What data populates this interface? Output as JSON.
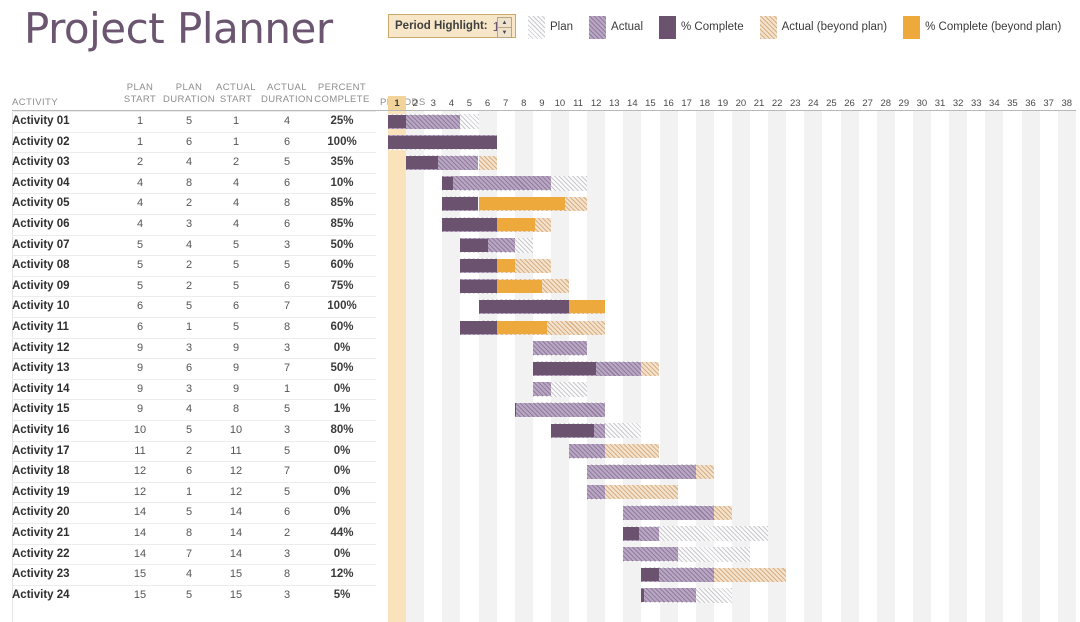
{
  "header": {
    "title": "Project Planner",
    "period_highlight": {
      "label": "Period Highlight:",
      "value": "1",
      "up_icon": "▲",
      "down_icon": "▼"
    },
    "legend": [
      {
        "label": "Plan",
        "swatch": "plan",
        "color": "#c9c9cd"
      },
      {
        "label": "Actual",
        "swatch": "actual",
        "color": "#b9a7c4"
      },
      {
        "label": "% Complete",
        "swatch": "complete",
        "color": "#6b5370"
      },
      {
        "label": "Actual (beyond plan)",
        "swatch": "actual-beyond",
        "color": "#d8b084"
      },
      {
        "label": "% Complete (beyond plan)",
        "swatch": "complete-beyond",
        "color": "#eda93c"
      }
    ]
  },
  "columns": {
    "activity": "ACTIVITY",
    "plan_start_l1": "PLAN",
    "plan_start_l2": "START",
    "plan_duration_l1": "PLAN",
    "plan_duration_l2": "DURATION",
    "actual_start_l1": "ACTUAL",
    "actual_start_l2": "START",
    "actual_duration_l1": "ACTUAL",
    "actual_duration_l2": "DURATION",
    "percent_complete_l1": "PERCENT",
    "percent_complete_l2": "COMPLETE",
    "periods": "PERIODS"
  },
  "chart_data": {
    "type": "bar",
    "title": "Project Planner",
    "subtype": "gantt",
    "xlabel": "PERIODS",
    "ylabel": "ACTIVITY",
    "xlim": [
      1,
      38
    ],
    "period_count": 38,
    "highlighted_period": 1,
    "grid": true,
    "legend_position": "top-right",
    "series": [
      {
        "name": "Plan",
        "color": "#c9c9cd"
      },
      {
        "name": "Actual",
        "color": "#b9a7c4"
      },
      {
        "name": "% Complete",
        "color": "#6b5370"
      },
      {
        "name": "Actual (beyond plan)",
        "color": "#d8b084"
      },
      {
        "name": "% Complete (beyond plan)",
        "color": "#eda93c"
      }
    ],
    "period_ticks": [
      1,
      2,
      3,
      4,
      5,
      6,
      7,
      8,
      9,
      10,
      11,
      12,
      13,
      14,
      15,
      16,
      17,
      18,
      19,
      20,
      21,
      22,
      23,
      24,
      25,
      26,
      27,
      28,
      29,
      30,
      31,
      32,
      33,
      34,
      35,
      36,
      37,
      38
    ],
    "categories": [
      "Activity 01",
      "Activity 02",
      "Activity 03",
      "Activity 04",
      "Activity 05",
      "Activity 06",
      "Activity 07",
      "Activity 08",
      "Activity 09",
      "Activity 10",
      "Activity 11",
      "Activity 12",
      "Activity 13",
      "Activity 14",
      "Activity 15",
      "Activity 16",
      "Activity 17",
      "Activity 18",
      "Activity 19",
      "Activity 20",
      "Activity 21",
      "Activity 22",
      "Activity 23",
      "Activity 24"
    ],
    "rows": [
      {
        "activity": "Activity 01",
        "plan_start": 1,
        "plan_duration": 5,
        "actual_start": 1,
        "actual_duration": 4,
        "percent_complete": "25%",
        "pct": 25
      },
      {
        "activity": "Activity 02",
        "plan_start": 1,
        "plan_duration": 6,
        "actual_start": 1,
        "actual_duration": 6,
        "percent_complete": "100%",
        "pct": 100
      },
      {
        "activity": "Activity 03",
        "plan_start": 2,
        "plan_duration": 4,
        "actual_start": 2,
        "actual_duration": 5,
        "percent_complete": "35%",
        "pct": 35
      },
      {
        "activity": "Activity 04",
        "plan_start": 4,
        "plan_duration": 8,
        "actual_start": 4,
        "actual_duration": 6,
        "percent_complete": "10%",
        "pct": 10
      },
      {
        "activity": "Activity 05",
        "plan_start": 4,
        "plan_duration": 2,
        "actual_start": 4,
        "actual_duration": 8,
        "percent_complete": "85%",
        "pct": 85
      },
      {
        "activity": "Activity 06",
        "plan_start": 4,
        "plan_duration": 3,
        "actual_start": 4,
        "actual_duration": 6,
        "percent_complete": "85%",
        "pct": 85
      },
      {
        "activity": "Activity 07",
        "plan_start": 5,
        "plan_duration": 4,
        "actual_start": 5,
        "actual_duration": 3,
        "percent_complete": "50%",
        "pct": 50
      },
      {
        "activity": "Activity 08",
        "plan_start": 5,
        "plan_duration": 2,
        "actual_start": 5,
        "actual_duration": 5,
        "percent_complete": "60%",
        "pct": 60
      },
      {
        "activity": "Activity 09",
        "plan_start": 5,
        "plan_duration": 2,
        "actual_start": 5,
        "actual_duration": 6,
        "percent_complete": "75%",
        "pct": 75
      },
      {
        "activity": "Activity 10",
        "plan_start": 6,
        "plan_duration": 5,
        "actual_start": 6,
        "actual_duration": 7,
        "percent_complete": "100%",
        "pct": 100
      },
      {
        "activity": "Activity 11",
        "plan_start": 6,
        "plan_duration": 1,
        "actual_start": 5,
        "actual_duration": 8,
        "percent_complete": "60%",
        "pct": 60
      },
      {
        "activity": "Activity 12",
        "plan_start": 9,
        "plan_duration": 3,
        "actual_start": 9,
        "actual_duration": 3,
        "percent_complete": "0%",
        "pct": 0
      },
      {
        "activity": "Activity 13",
        "plan_start": 9,
        "plan_duration": 6,
        "actual_start": 9,
        "actual_duration": 7,
        "percent_complete": "50%",
        "pct": 50
      },
      {
        "activity": "Activity 14",
        "plan_start": 9,
        "plan_duration": 3,
        "actual_start": 9,
        "actual_duration": 1,
        "percent_complete": "0%",
        "pct": 0
      },
      {
        "activity": "Activity 15",
        "plan_start": 9,
        "plan_duration": 4,
        "actual_start": 8,
        "actual_duration": 5,
        "percent_complete": "1%",
        "pct": 1
      },
      {
        "activity": "Activity 16",
        "plan_start": 10,
        "plan_duration": 5,
        "actual_start": 10,
        "actual_duration": 3,
        "percent_complete": "80%",
        "pct": 80
      },
      {
        "activity": "Activity 17",
        "plan_start": 11,
        "plan_duration": 2,
        "actual_start": 11,
        "actual_duration": 5,
        "percent_complete": "0%",
        "pct": 0
      },
      {
        "activity": "Activity 18",
        "plan_start": 12,
        "plan_duration": 6,
        "actual_start": 12,
        "actual_duration": 7,
        "percent_complete": "0%",
        "pct": 0
      },
      {
        "activity": "Activity 19",
        "plan_start": 12,
        "plan_duration": 1,
        "actual_start": 12,
        "actual_duration": 5,
        "percent_complete": "0%",
        "pct": 0
      },
      {
        "activity": "Activity 20",
        "plan_start": 14,
        "plan_duration": 5,
        "actual_start": 14,
        "actual_duration": 6,
        "percent_complete": "0%",
        "pct": 0
      },
      {
        "activity": "Activity 21",
        "plan_start": 14,
        "plan_duration": 8,
        "actual_start": 14,
        "actual_duration": 2,
        "percent_complete": "44%",
        "pct": 44
      },
      {
        "activity": "Activity 22",
        "plan_start": 14,
        "plan_duration": 7,
        "actual_start": 14,
        "actual_duration": 3,
        "percent_complete": "0%",
        "pct": 0
      },
      {
        "activity": "Activity 23",
        "plan_start": 15,
        "plan_duration": 4,
        "actual_start": 15,
        "actual_duration": 8,
        "percent_complete": "12%",
        "pct": 12
      },
      {
        "activity": "Activity 24",
        "plan_start": 15,
        "plan_duration": 5,
        "actual_start": 15,
        "actual_duration": 3,
        "percent_complete": "5%",
        "pct": 5
      }
    ]
  }
}
